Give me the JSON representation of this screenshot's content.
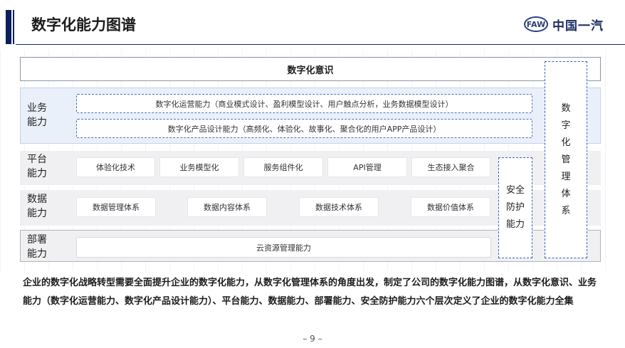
{
  "header": {
    "title": "数字化能力图谱",
    "logo_emblem": "FAW",
    "logo_text": "中国一汽"
  },
  "top_band": {
    "label": "数字化意识"
  },
  "rows": {
    "business": {
      "label": "业务能力",
      "items": [
        "数字化运营能力（商业模式设计、盈利模型设计、用户触点分析，业务数据模型设计）",
        "数字化产品设计能力（高频化、体验化、故事化、聚合化的用户APP产品设计）"
      ]
    },
    "platform": {
      "label": "平台能力",
      "items": [
        "体验化技术",
        "业务模型化",
        "服务组件化",
        "API管理",
        "生态接入聚合"
      ]
    },
    "data": {
      "label": "数据能力",
      "items": [
        "数据管理体系",
        "数据内容体系",
        "数据技术体系",
        "数据价值体系"
      ]
    },
    "deploy": {
      "label": "部署能力",
      "items": [
        "云资源管理能力"
      ]
    }
  },
  "security_box": {
    "label": "安全防护能力"
  },
  "mgmt_box": {
    "label": "数字化管理体系"
  },
  "description": "企业的数字化战略转型需要全面提升企业的数字化能力，从数字化管理体系的角度出发，制定了公司的数字化能力图谱，从数字化意识、业务能力（数字化运营能力、数字化产品设计能力）、平台能力、数据能力、部署能力、安全防护能力六个层次定义了企业的数字化能力全集",
  "page_number": "– 9 –"
}
